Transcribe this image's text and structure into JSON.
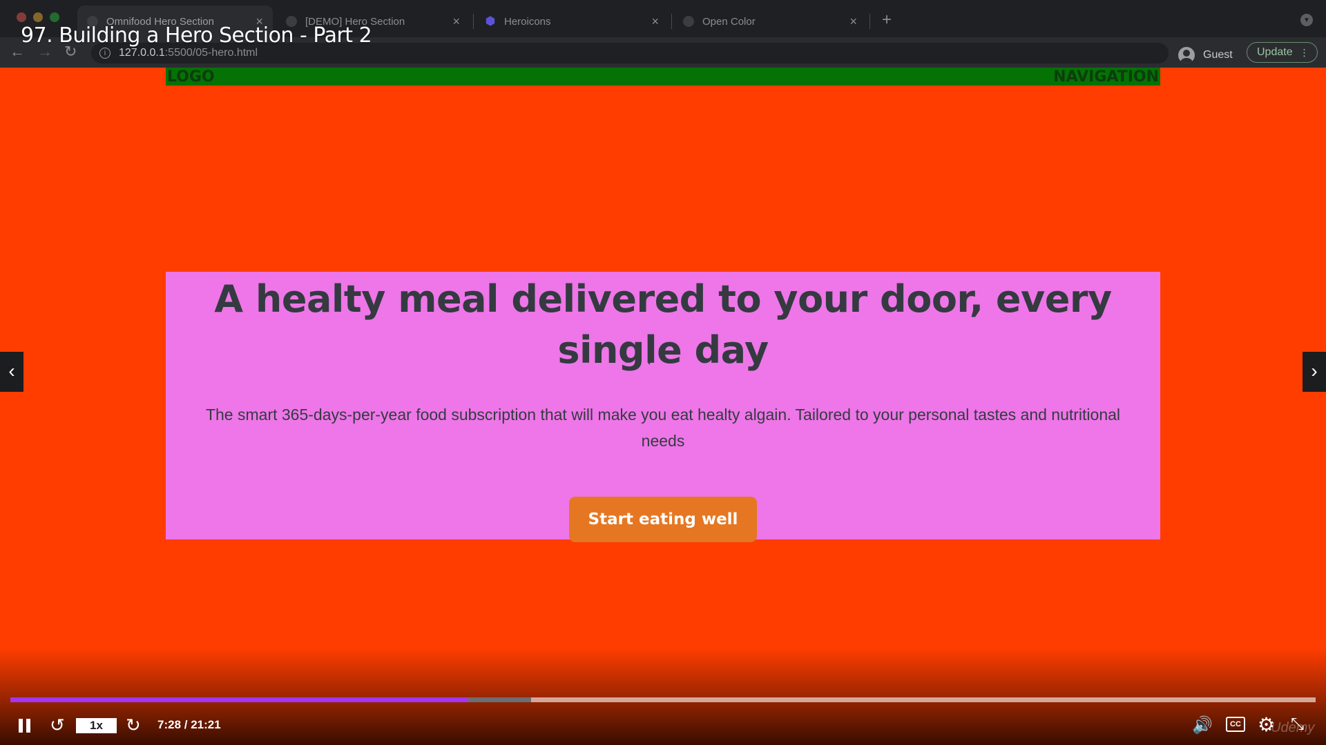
{
  "browser": {
    "tabs": [
      {
        "title": "Omnifood Hero Section",
        "active": true,
        "icon": "page-favicon"
      },
      {
        "title": "[DEMO] Hero Section",
        "active": false,
        "icon": "page-favicon"
      },
      {
        "title": "Heroicons",
        "active": false,
        "icon": "shield-icon"
      },
      {
        "title": "Open Color",
        "active": false,
        "icon": "page-favicon"
      }
    ],
    "tab_close_glyph": "×",
    "new_tab_glyph": "+",
    "url_host": "127.0.0.1",
    "url_path": ":5500/05-hero.html",
    "profile_label": "Guest",
    "update_label": "Update"
  },
  "lecture": {
    "title": "97. Building a Hero Section - Part 2"
  },
  "page": {
    "header": {
      "logo": "LOGO",
      "navigation": "NAVIGATION",
      "background_color": "#057205"
    },
    "hero": {
      "heading": "A healty meal delivered to your door, every single day",
      "description": "The smart 365-days-per-year food subscription that will make you eat healty algain. Tailored to your personal tastes and nutritional needs",
      "cta_label": "Start eating well",
      "background_color": "#ee76e8",
      "cta_color": "#e67722"
    },
    "body_background": "#ff3d00"
  },
  "player": {
    "speed": "1x",
    "time": "7:28 / 21:21",
    "progress_played": 0.351,
    "progress_buffered": 0.399,
    "accent_color": "#a435f0",
    "captions_label": "CC",
    "watermark": "Udemy"
  }
}
